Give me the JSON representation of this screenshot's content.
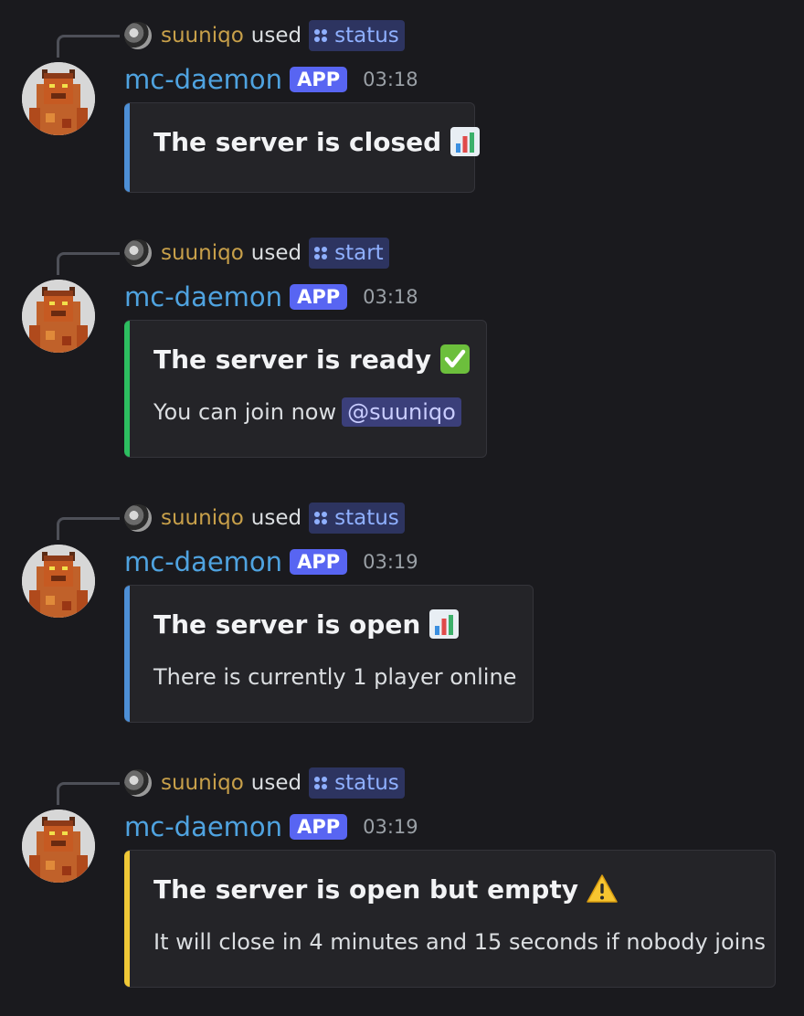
{
  "colors": {
    "background": "#1a1a1e",
    "embed_bg": "#242428",
    "blue_bar": "#4d8fd6",
    "green_bar": "#2dbe60",
    "yellow_bar": "#f0c836",
    "app_badge": "#5865f2",
    "author": "#4fa3e0",
    "username": "#c8a04a"
  },
  "messages": [
    {
      "reply": {
        "user": "suuniqo",
        "used": "used",
        "command": "status",
        "avatar_icon": "user-avatar-icon"
      },
      "author": "mc-daemon",
      "badge": "APP",
      "time": "03:18",
      "avatar_icon": "minecraft-avatar-icon",
      "embed": {
        "bar_color": "blue",
        "title": "The server is closed",
        "emoji": "bar-chart-emoji",
        "description": ""
      }
    },
    {
      "reply": {
        "user": "suuniqo",
        "used": "used",
        "command": "start",
        "avatar_icon": "user-avatar-icon"
      },
      "author": "mc-daemon",
      "badge": "APP",
      "time": "03:18",
      "avatar_icon": "minecraft-avatar-icon",
      "embed": {
        "bar_color": "green",
        "title": "The server is ready",
        "emoji": "check-mark-emoji",
        "description": "You can join now",
        "mention": "@suuniqo"
      }
    },
    {
      "reply": {
        "user": "suuniqo",
        "used": "used",
        "command": "status",
        "avatar_icon": "user-avatar-icon"
      },
      "author": "mc-daemon",
      "badge": "APP",
      "time": "03:19",
      "avatar_icon": "minecraft-avatar-icon",
      "embed": {
        "bar_color": "blue",
        "title": "The server is open",
        "emoji": "bar-chart-emoji",
        "description": "There is currently 1 player online"
      }
    },
    {
      "reply": {
        "user": "suuniqo",
        "used": "used",
        "command": "status",
        "avatar_icon": "user-avatar-icon"
      },
      "author": "mc-daemon",
      "badge": "APP",
      "time": "03:19",
      "avatar_icon": "minecraft-avatar-icon",
      "embed": {
        "bar_color": "yellow",
        "title": "The server is open but empty",
        "emoji": "warning-emoji",
        "description": "It will close in 4 minutes and 15 seconds if nobody joins"
      }
    }
  ]
}
